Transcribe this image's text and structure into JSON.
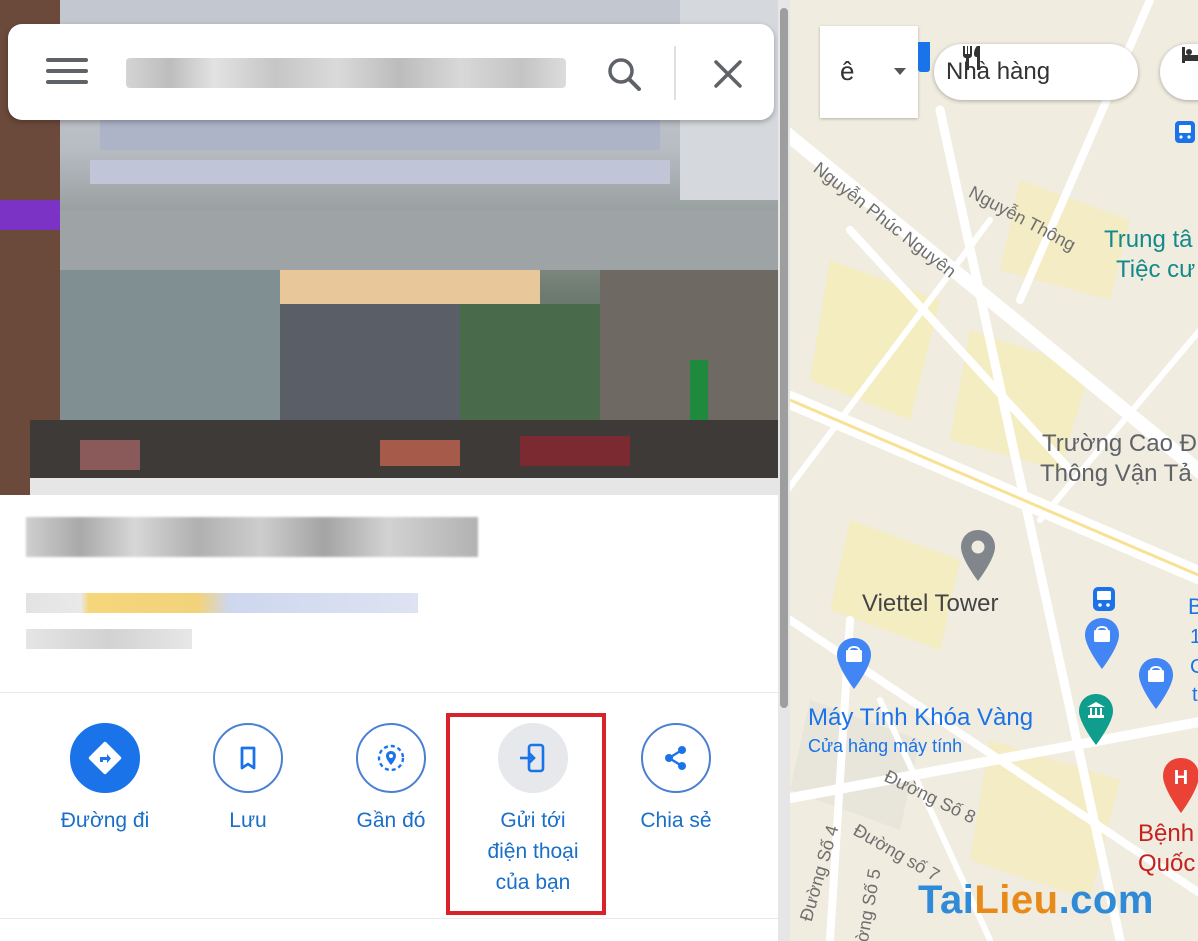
{
  "search": {
    "menu_icon": "hamburger-menu-icon",
    "search_icon": "search-icon",
    "close_icon": "close-icon"
  },
  "actions": [
    {
      "label": "Đường đi",
      "icon": "directions-icon",
      "style": "filled"
    },
    {
      "label": "Lưu",
      "icon": "bookmark-icon",
      "style": "outline"
    },
    {
      "label": "Gần đó",
      "icon": "nearby-icon",
      "style": "outline"
    },
    {
      "label": "Gửi tới điện thoại của bạn",
      "icon": "send-to-phone-icon",
      "style": "highlighted"
    },
    {
      "label": "Chia sẻ",
      "icon": "share-icon",
      "style": "outline"
    }
  ],
  "map": {
    "lang_chip": "ê",
    "category_chip_label": "Nhà hàng",
    "labels": {
      "street_nguyen_thong": "Nguyễn Thông",
      "street_nguyen_phuc_nguyen": "Nguyễn Phúc Nguyên",
      "poi_trung_tam_line1": "Trung tâ",
      "poi_trung_tam_line2": "Tiệc cư",
      "poi_truong_line1": "Trường Cao Đ",
      "poi_truong_line2": "Thông Vận Tả",
      "viettel_tower": "Viettel Tower",
      "may_tinh": "Máy Tính Khóa Vàng",
      "cua_hang": "Cửa hàng máy tính",
      "duong_so_8": "Đường Số 8",
      "duong_so_7": "Đường số 7",
      "duong_so_4": "Đường Số 4",
      "duong_so_5": "ờng Số 5",
      "benh_line1": "Bệnh",
      "benh_line2": "Quốc",
      "partial_b": "B",
      "partial_1": "1",
      "partial_c": "C",
      "partial_t": "t"
    },
    "colors": {
      "background": "#f0ecdf",
      "shopping_pin": "#4285f4",
      "attraction_pin": "#0f9d8e",
      "hospital_pin": "#ea4335",
      "place_pin": "#80868b",
      "highlight": "#d8232a"
    }
  },
  "watermark": {
    "part1": "Tai",
    "part2": "Lieu",
    "part3": ".com"
  }
}
